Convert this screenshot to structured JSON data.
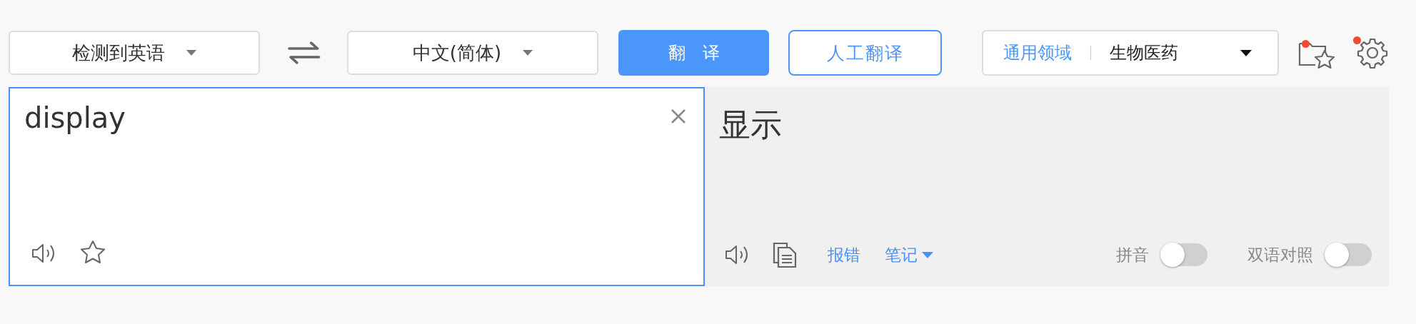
{
  "toolbar": {
    "source_language": "检测到英语",
    "target_language": "中文(简体)",
    "translate_button": "翻　译",
    "human_translation_button": "人工翻译",
    "domain": {
      "general": "通用领域",
      "selected": "生物医药"
    },
    "favorites_badge": true,
    "settings_badge": true
  },
  "source": {
    "value": "display",
    "focused": true
  },
  "result": {
    "text": "显示",
    "report_link": "报错",
    "notes_link": "笔记",
    "toggles": [
      {
        "label": "拼音",
        "on": false
      },
      {
        "label": "双语对照",
        "on": false
      }
    ]
  }
}
